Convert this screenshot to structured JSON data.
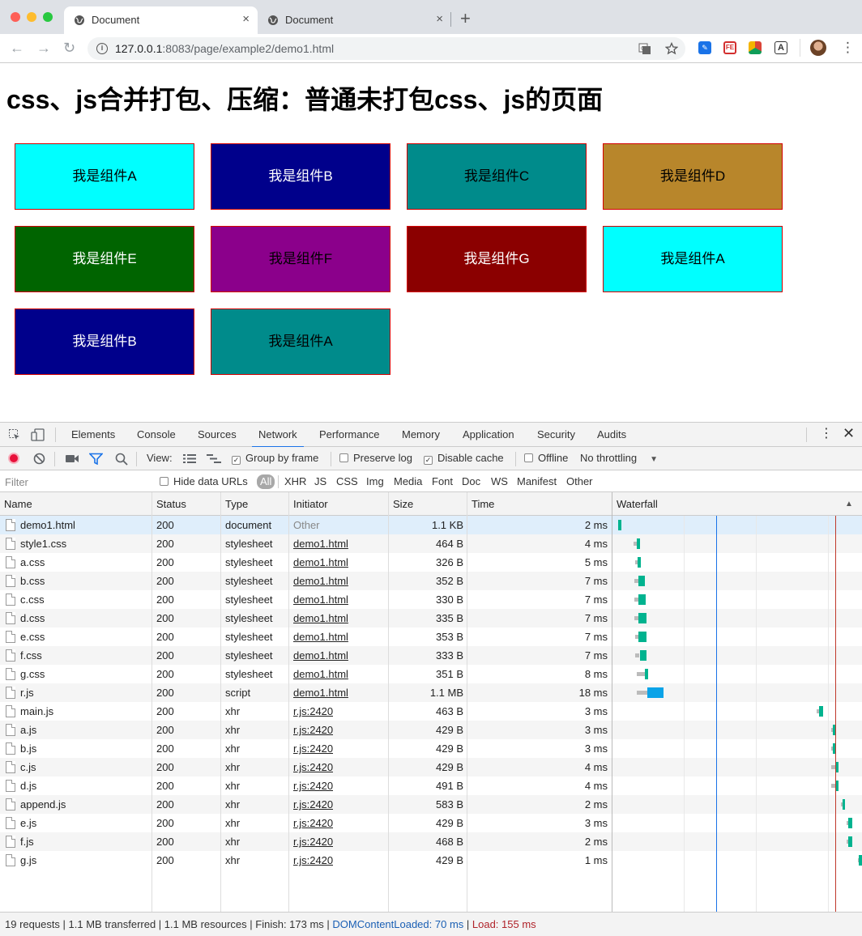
{
  "browser": {
    "tabs": [
      {
        "title": "Document",
        "close": "×"
      },
      {
        "title": "Document",
        "close": "×"
      }
    ],
    "new_tab": "+",
    "url_host": "127.0.0.1",
    "url_path": ":8083/page/example2/demo1.html",
    "nav": {
      "back": "←",
      "forward": "→",
      "reload": "↻"
    },
    "extensions": [
      "translate-icon",
      "star-icon",
      "feedly-icon",
      "fe-icon",
      "chrome-ext-icon",
      "text-icon",
      "avatar"
    ],
    "ext_labels": {
      "fe": "FE",
      "text": "A"
    },
    "menu": "⋮"
  },
  "page": {
    "title": "css、js合并打包、压缩：普通未打包css、js的页面",
    "components": [
      {
        "label": "我是组件A",
        "bg": "#00ffff",
        "fg": "#000000"
      },
      {
        "label": "我是组件B",
        "bg": "#00008b",
        "fg": "#ffffff"
      },
      {
        "label": "我是组件C",
        "bg": "#008b8b",
        "fg": "#000000"
      },
      {
        "label": "我是组件D",
        "bg": "#b8862b",
        "fg": "#000000"
      },
      {
        "label": "我是组件E",
        "bg": "#006400",
        "fg": "#ffffff"
      },
      {
        "label": "我是组件F",
        "bg": "#8b008b",
        "fg": "#000000"
      },
      {
        "label": "我是组件G",
        "bg": "#8b0000",
        "fg": "#ffffff"
      },
      {
        "label": "我是组件A",
        "bg": "#00ffff",
        "fg": "#000000"
      },
      {
        "label": "我是组件B",
        "bg": "#00008b",
        "fg": "#ffffff"
      },
      {
        "label": "我是组件A",
        "bg": "#008b8b",
        "fg": "#000000"
      }
    ]
  },
  "devtools": {
    "tabs": [
      "Elements",
      "Console",
      "Sources",
      "Network",
      "Performance",
      "Memory",
      "Application",
      "Security",
      "Audits"
    ],
    "active_tab": "Network",
    "toolbar": {
      "view_label": "View:",
      "group_by_frame": "Group by frame",
      "preserve_log": "Preserve log",
      "disable_cache": "Disable cache",
      "offline": "Offline",
      "throttling": "No throttling",
      "group_by_frame_checked": true,
      "preserve_log_checked": false,
      "disable_cache_checked": true,
      "offline_checked": false
    },
    "filter": {
      "placeholder": "Filter",
      "hide_data_urls": "Hide data URLs",
      "types": [
        "All",
        "XHR",
        "JS",
        "CSS",
        "Img",
        "Media",
        "Font",
        "Doc",
        "WS",
        "Manifest",
        "Other"
      ]
    },
    "columns": [
      "Name",
      "Status",
      "Type",
      "Initiator",
      "Size",
      "Time",
      "Waterfall"
    ],
    "waterfall_sort": "▲",
    "rows": [
      {
        "name": "demo1.html",
        "status": "200",
        "type": "document",
        "initiator": "Other",
        "size": "1.1 KB",
        "time": "2 ms"
      },
      {
        "name": "style1.css",
        "status": "200",
        "type": "stylesheet",
        "initiator": "demo1.html",
        "size": "464 B",
        "time": "4 ms"
      },
      {
        "name": "a.css",
        "status": "200",
        "type": "stylesheet",
        "initiator": "demo1.html",
        "size": "326 B",
        "time": "5 ms"
      },
      {
        "name": "b.css",
        "status": "200",
        "type": "stylesheet",
        "initiator": "demo1.html",
        "size": "352 B",
        "time": "7 ms"
      },
      {
        "name": "c.css",
        "status": "200",
        "type": "stylesheet",
        "initiator": "demo1.html",
        "size": "330 B",
        "time": "7 ms"
      },
      {
        "name": "d.css",
        "status": "200",
        "type": "stylesheet",
        "initiator": "demo1.html",
        "size": "335 B",
        "time": "7 ms"
      },
      {
        "name": "e.css",
        "status": "200",
        "type": "stylesheet",
        "initiator": "demo1.html",
        "size": "353 B",
        "time": "7 ms"
      },
      {
        "name": "f.css",
        "status": "200",
        "type": "stylesheet",
        "initiator": "demo1.html",
        "size": "333 B",
        "time": "7 ms"
      },
      {
        "name": "g.css",
        "status": "200",
        "type": "stylesheet",
        "initiator": "demo1.html",
        "size": "351 B",
        "time": "8 ms"
      },
      {
        "name": "r.js",
        "status": "200",
        "type": "script",
        "initiator": "demo1.html",
        "size": "1.1 MB",
        "time": "18 ms"
      },
      {
        "name": "main.js",
        "status": "200",
        "type": "xhr",
        "initiator": "r.js:2420",
        "size": "463 B",
        "time": "3 ms"
      },
      {
        "name": "a.js",
        "status": "200",
        "type": "xhr",
        "initiator": "r.js:2420",
        "size": "429 B",
        "time": "3 ms"
      },
      {
        "name": "b.js",
        "status": "200",
        "type": "xhr",
        "initiator": "r.js:2420",
        "size": "429 B",
        "time": "3 ms"
      },
      {
        "name": "c.js",
        "status": "200",
        "type": "xhr",
        "initiator": "r.js:2420",
        "size": "429 B",
        "time": "4 ms"
      },
      {
        "name": "d.js",
        "status": "200",
        "type": "xhr",
        "initiator": "r.js:2420",
        "size": "491 B",
        "time": "4 ms"
      },
      {
        "name": "append.js",
        "status": "200",
        "type": "xhr",
        "initiator": "r.js:2420",
        "size": "583 B",
        "time": "2 ms"
      },
      {
        "name": "e.js",
        "status": "200",
        "type": "xhr",
        "initiator": "r.js:2420",
        "size": "429 B",
        "time": "3 ms"
      },
      {
        "name": "f.js",
        "status": "200",
        "type": "xhr",
        "initiator": "r.js:2420",
        "size": "468 B",
        "time": "2 ms"
      },
      {
        "name": "g.js",
        "status": "200",
        "type": "xhr",
        "initiator": "r.js:2420",
        "size": "429 B",
        "time": "1 ms"
      }
    ],
    "status": {
      "summary": "19 requests | 1.1 MB transferred | 1.1 MB resources | Finish: 173 ms | ",
      "dcl": "DOMContentLoaded: 70 ms",
      "sep": " | ",
      "load": "Load: 155 ms"
    },
    "colors": {
      "dcl_line": "#1a73e8",
      "load_line": "#c0392b",
      "bar_green": "#00b38f",
      "bar_blue": "#0aa3e8"
    }
  }
}
